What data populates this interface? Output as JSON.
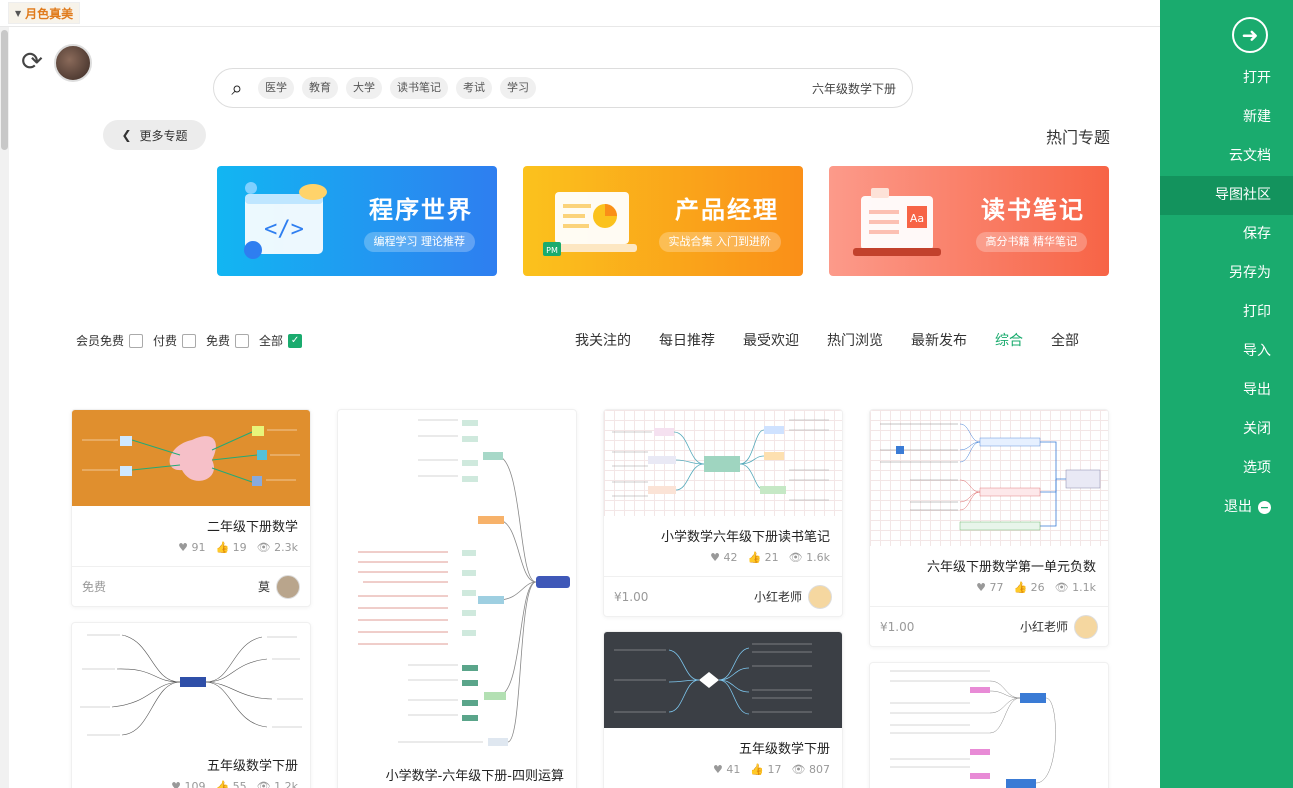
{
  "theme": {
    "label": "月色真美"
  },
  "search": {
    "query": "六年级数学下册",
    "tags": [
      "学习",
      "考试",
      "读书笔记",
      "大学",
      "教育",
      "医学"
    ]
  },
  "section": {
    "title": "热门专题",
    "more_label": "更多专题"
  },
  "banners": [
    {
      "title": "程序世界",
      "subtitle": "编程学习 理论推荐"
    },
    {
      "title": "产品经理",
      "subtitle": "实战合集 入门到进阶"
    },
    {
      "title": "读书笔记",
      "subtitle": "高分书籍 精华笔记"
    }
  ],
  "filters": [
    {
      "label": "全部",
      "checked": true
    },
    {
      "label": "免费",
      "checked": false
    },
    {
      "label": "付费",
      "checked": false
    },
    {
      "label": "会员免费",
      "checked": false
    }
  ],
  "tabs": [
    {
      "label": "全部",
      "active": false
    },
    {
      "label": "综合",
      "active": true
    },
    {
      "label": "最新发布",
      "active": false
    },
    {
      "label": "热门浏览",
      "active": false
    },
    {
      "label": "最受欢迎",
      "active": false
    },
    {
      "label": "每日推荐",
      "active": false
    },
    {
      "label": "我关注的",
      "active": false
    }
  ],
  "cards": [
    {
      "title": "二年级下册数学",
      "views": "2.3k",
      "likes": "19",
      "favs": "91",
      "price": "免费",
      "author": "莫"
    },
    {
      "title": "五年级数学下册",
      "views": "1.2k",
      "likes": "55",
      "favs": "109"
    },
    {
      "title": "小学数学-六年级下册-四则运算"
    },
    {
      "title": "小学数学六年级下册读书笔记",
      "views": "1.6k",
      "likes": "21",
      "favs": "42",
      "price": "¥1.00",
      "author": "小红老师"
    },
    {
      "title": "五年级数学下册",
      "views": "807",
      "likes": "17",
      "favs": "41"
    },
    {
      "title": "六年级下册数学第一单元负数",
      "views": "1.1k",
      "likes": "26",
      "favs": "77",
      "price": "¥1.00",
      "author": "小红老师"
    }
  ],
  "sidebar": {
    "items": [
      "打开",
      "新建",
      "云文档",
      "导图社区",
      "保存",
      "另存为",
      "打印",
      "导入",
      "导出",
      "关闭",
      "选项",
      "退出"
    ],
    "active_index": 3
  },
  "colors": {
    "accent": "#1aab6e",
    "accent_dark": "#13935d"
  }
}
